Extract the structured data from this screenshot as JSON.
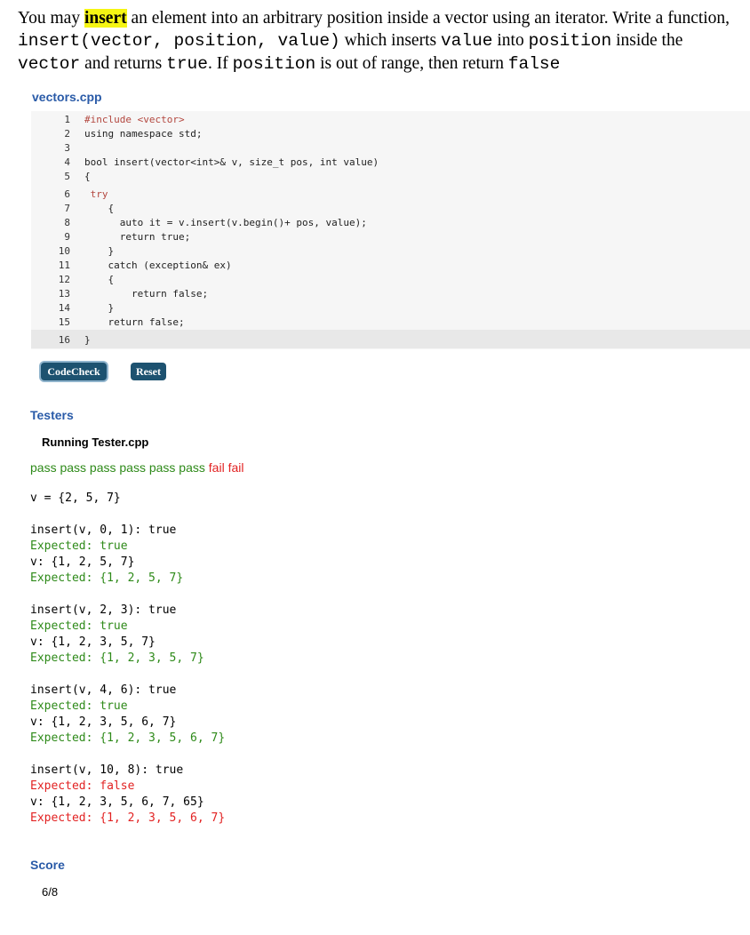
{
  "prompt": {
    "p1": "You may ",
    "p2": "insert",
    "p3": " an element into an arbitrary position inside a vector using an iterator. Write a function, ",
    "p4": "insert(vector, position, value)",
    "p5": " which inserts ",
    "p6": "value",
    "p7": " into ",
    "p8": "position",
    "p9": " inside the ",
    "p10": "vector",
    "p11": " and returns ",
    "p12": "true",
    "p13": ". If ",
    "p14": "position",
    "p15": " is out of range, then return ",
    "p16": "false"
  },
  "file_name": "vectors.cpp",
  "code_lines": [
    {
      "n": "1",
      "t": "#include <vector>"
    },
    {
      "n": "2",
      "t": "using namespace std;"
    },
    {
      "n": "3",
      "t": ""
    },
    {
      "n": "4",
      "t": "bool insert(vector<int>& v, size_t pos, int value)"
    },
    {
      "n": "5",
      "t": "{"
    },
    {
      "n": "6",
      "t": " try"
    },
    {
      "n": "7",
      "t": "    {"
    },
    {
      "n": "8",
      "t": "      auto it = v.insert(v.begin()+ pos, value);"
    },
    {
      "n": "9",
      "t": "      return true;"
    },
    {
      "n": "10",
      "t": "    }"
    },
    {
      "n": "11",
      "t": "    catch (exception& ex)"
    },
    {
      "n": "12",
      "t": "    {"
    },
    {
      "n": "13",
      "t": "        return false;"
    },
    {
      "n": "14",
      "t": "    }"
    },
    {
      "n": "15",
      "t": "    return false;"
    },
    {
      "n": "16",
      "t": "}"
    }
  ],
  "buttons": {
    "codecheck": "CodeCheck",
    "reset": "Reset"
  },
  "testers": {
    "heading": "Testers",
    "running": "Running Tester.cpp",
    "results_pass": "pass pass pass pass pass pass",
    "results_fail": "fail fail",
    "init": "v = {2, 5, 7}",
    "cases": [
      {
        "call": "insert(v, 0, 1): true",
        "exp_ret": "Expected: true",
        "v": "v: {1, 2, 5, 7}",
        "exp_v": "Expected: {1, 2, 5, 7}"
      },
      {
        "call": "insert(v, 2, 3): true",
        "exp_ret": "Expected: true",
        "v": "v: {1, 2, 3, 5, 7}",
        "exp_v": "Expected: {1, 2, 3, 5, 7}"
      },
      {
        "call": "insert(v, 4, 6): true",
        "exp_ret": "Expected: true",
        "v": "v: {1, 2, 3, 5, 6, 7}",
        "exp_v": "Expected: {1, 2, 3, 5, 6, 7}"
      },
      {
        "call": "insert(v, 10, 8): true",
        "exp_ret": "Expected: false",
        "v": "v: {1, 2, 3, 5, 6, 7, 65}",
        "exp_v": "Expected: {1, 2, 3, 5, 6, 7}"
      }
    ]
  },
  "score": {
    "heading": "Score",
    "value": "6/8"
  },
  "colors": {
    "pass": "#2e8a19",
    "fail": "#e22222",
    "heading": "#2a5ba8",
    "button": "#1d5270",
    "highlight": "#f5f513"
  }
}
